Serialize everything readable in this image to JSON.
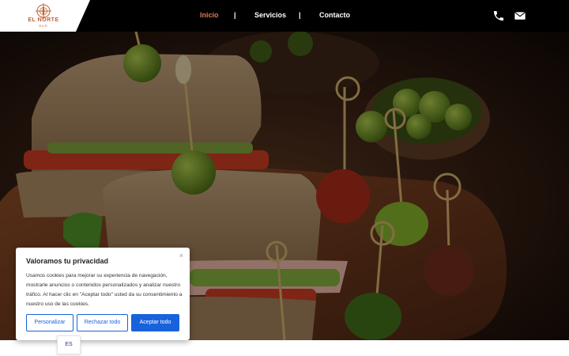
{
  "header": {
    "logo": {
      "name": "EL NORTE",
      "tagline": "BAR"
    },
    "nav": [
      {
        "label": "Inicio",
        "active": true
      },
      {
        "label": "Servicios",
        "active": false
      },
      {
        "label": "Contacto",
        "active": false
      }
    ],
    "separator": "|",
    "icons": [
      "phone-icon",
      "envelope-icon"
    ],
    "colors": {
      "background": "#000000",
      "active": "#e07a4d",
      "logo": "#c2623a"
    }
  },
  "hero": {
    "image": "sandwiches-and-skewered-appetizers-on-wooden-board"
  },
  "cookie_banner": {
    "title": "Valoramos tu privacidad",
    "close": "×",
    "body": "Usamos cookies para mejorar su experiencia de navegación, mostrarle anuncios o contenidos personalizados y analizar nuestro tráfico. Al hacer clic en \"Aceptar todo\" usted da su consentimiento a nuestro uso de las cookies.",
    "buttons": {
      "customize": "Personalizar",
      "reject": "Rechazar todo",
      "accept": "Aceptar todo"
    },
    "accent": "#1863dc"
  },
  "language": {
    "current": "ES"
  }
}
